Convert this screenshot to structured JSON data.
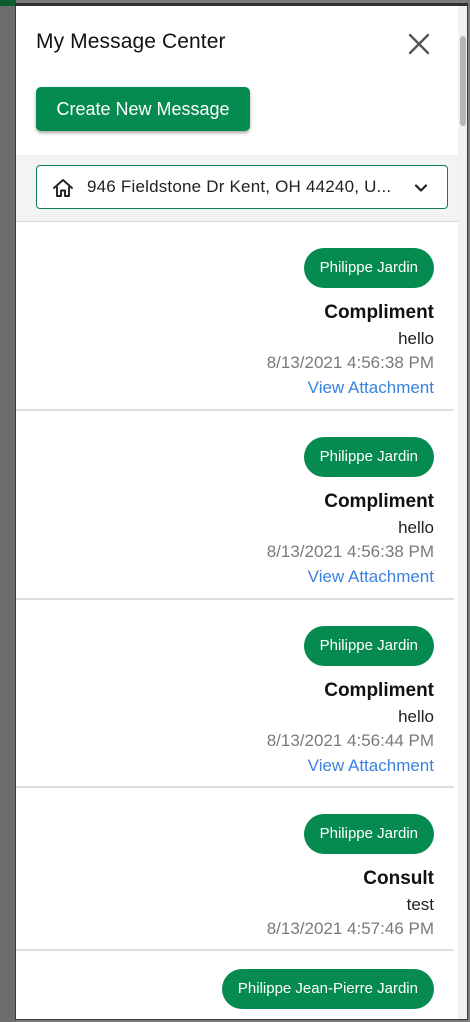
{
  "header": {
    "title": "My Message Center",
    "create_button_label": "Create New Message"
  },
  "filter": {
    "address_selected": "946 Fieldstone Dr Kent, OH 44240, U...",
    "icon": "home-icon",
    "dropdown_icon": "chevron-down-icon"
  },
  "messages": [
    {
      "sender": "Philippe Jardin",
      "subject": "Compliment",
      "body": "hello",
      "date": "8/13/2021 4:56:38 PM",
      "attachment_label": "View Attachment"
    },
    {
      "sender": "Philippe Jardin",
      "subject": "Compliment",
      "body": "hello",
      "date": "8/13/2021 4:56:38 PM",
      "attachment_label": "View Attachment"
    },
    {
      "sender": "Philippe Jardin",
      "subject": "Compliment",
      "body": "hello",
      "date": "8/13/2021 4:56:44 PM",
      "attachment_label": "View Attachment"
    },
    {
      "sender": "Philippe Jardin",
      "subject": "Consult",
      "body": "test",
      "date": "8/13/2021 4:57:46 PM"
    },
    {
      "sender": "Philippe Jean-Pierre Jardin"
    }
  ],
  "colors": {
    "accent": "#058a50",
    "link": "#3b82e0",
    "muted_text": "#7a7a7a"
  }
}
